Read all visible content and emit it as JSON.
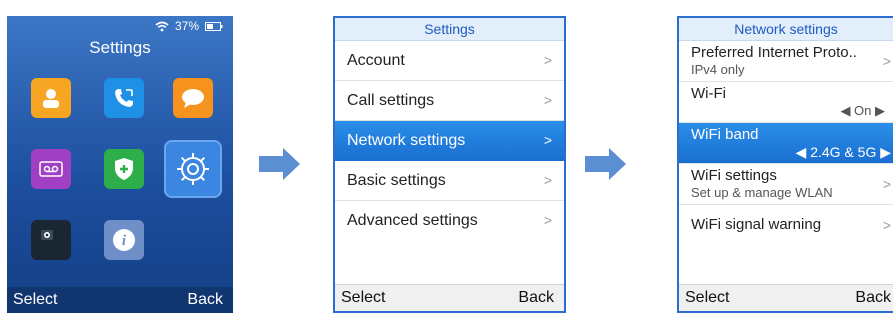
{
  "screen1": {
    "status": {
      "battery": "37%",
      "wifi_icon": "wifi-icon",
      "battery_icon": "battery-icon"
    },
    "title": "Settings",
    "apps": [
      {
        "name": "contacts-icon",
        "color": "#f6a623"
      },
      {
        "name": "call-history-icon",
        "color": "#1e90e6"
      },
      {
        "name": "messages-icon",
        "color": "#f5931e"
      },
      {
        "name": "voicemail-icon",
        "color": "#a03ec4"
      },
      {
        "name": "security-shield-icon",
        "color": "#2dae4a"
      },
      {
        "name": "settings-gear-icon",
        "color": "#3a86e0"
      },
      {
        "name": "camera-icon",
        "color": "#1b2633"
      },
      {
        "name": "info-icon",
        "color": "#6f8fc9"
      }
    ],
    "softkeys": {
      "left": "Select",
      "right": "Back"
    }
  },
  "screen2": {
    "header": "Settings",
    "items": [
      {
        "label": "Account",
        "chevron": ">"
      },
      {
        "label": "Call settings",
        "chevron": ">"
      },
      {
        "label": "Network settings",
        "chevron": ">"
      },
      {
        "label": "Basic settings",
        "chevron": ">"
      },
      {
        "label": "Advanced settings",
        "chevron": ">"
      }
    ],
    "softkeys": {
      "left": "Select",
      "right": "Back"
    }
  },
  "screen3": {
    "header": "Network settings",
    "items": [
      {
        "label": "Preferred Internet Proto..",
        "sub": "IPv4 only",
        "chevron": ">"
      },
      {
        "label": "Wi-Fi",
        "value": "◀ On ▶"
      },
      {
        "label": "WiFi band",
        "value": "◀ 2.4G & 5G ▶"
      },
      {
        "label": "WiFi settings",
        "sub": "Set up & manage WLAN",
        "chevron": ">"
      },
      {
        "label": "WiFi signal warning",
        "chevron": ">"
      }
    ],
    "softkeys": {
      "left": "Select",
      "right": "Back"
    }
  },
  "colors": {
    "accent": "#1a6fd0",
    "arrow": "#5b8fd1"
  }
}
